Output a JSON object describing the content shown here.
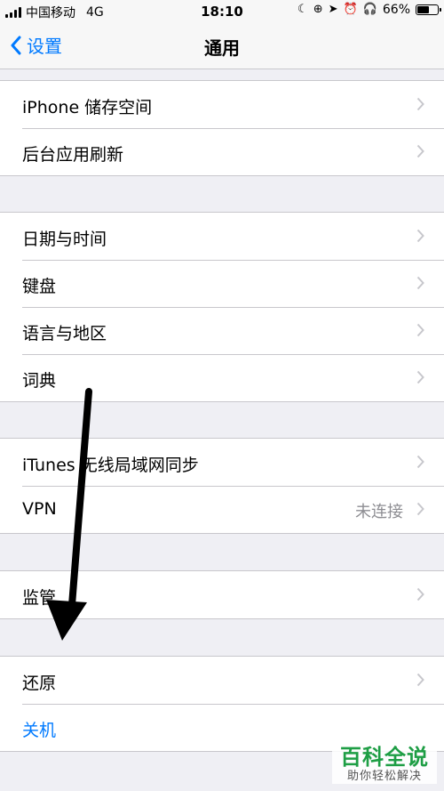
{
  "status_bar": {
    "carrier": "中国移动",
    "network": "4G",
    "time": "18:10",
    "battery_percent": "66%",
    "battery_level": 0.66
  },
  "nav": {
    "back_label": "设置",
    "title": "通用"
  },
  "groups": [
    {
      "rows": [
        {
          "label": "iPhone 储存空间"
        },
        {
          "label": "后台应用刷新"
        }
      ]
    },
    {
      "rows": [
        {
          "label": "日期与时间"
        },
        {
          "label": "键盘"
        },
        {
          "label": "语言与地区"
        },
        {
          "label": "词典"
        }
      ]
    },
    {
      "rows": [
        {
          "label": "iTunes 无线局域网同步"
        },
        {
          "label": "VPN",
          "value": "未连接"
        }
      ]
    },
    {
      "rows": [
        {
          "label": "监管"
        }
      ]
    },
    {
      "rows": [
        {
          "label": "还原"
        },
        {
          "label": "关机"
        }
      ]
    }
  ],
  "watermark": {
    "title": "百科全说",
    "subtitle": "助你轻松解决"
  },
  "colors": {
    "accent": "#007aff",
    "background": "#efeff4",
    "separator": "#c8c7cc",
    "watermark_green": "#1e9e45"
  }
}
